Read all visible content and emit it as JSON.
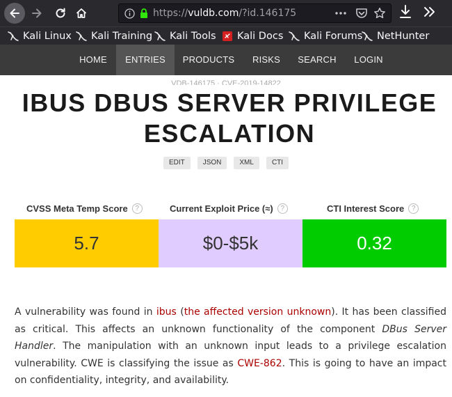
{
  "browser": {
    "url_prefix": "https://",
    "url_host": "vuldb.com",
    "url_path": "/?id.146175",
    "bookmarks": [
      {
        "label": "Kali Linux",
        "icon": "kali-dragon-icon"
      },
      {
        "label": "Kali Training",
        "icon": "kali-dragon-icon"
      },
      {
        "label": "Kali Tools",
        "icon": "kali-dragon-icon"
      },
      {
        "label": "Kali Docs",
        "icon": "kali-docs-icon"
      },
      {
        "label": "Kali Forums",
        "icon": "kali-dragon-icon"
      },
      {
        "label": "NetHunter",
        "icon": "kali-dragon-icon"
      }
    ]
  },
  "nav": {
    "items": [
      "HOME",
      "ENTRIES",
      "PRODUCTS",
      "RISKS",
      "SEARCH",
      "LOGIN"
    ],
    "active": "ENTRIES"
  },
  "entry": {
    "subhead": "VDB-146175 · CVE-2019-14822",
    "title": "IBUS DBUS SERVER PRIVILEGE ESCALATION",
    "formats": [
      "EDIT",
      "JSON",
      "XML",
      "CTI"
    ]
  },
  "scores": {
    "cvss_label": "CVSS Meta Temp Score",
    "cvss_value": "5.7",
    "price_label": "Current Exploit Price (≈)",
    "price_value": "$0-$5k",
    "cti_label": "CTI Interest Score",
    "cti_value": "0.32",
    "help_glyph": "?",
    "colors": {
      "cvss": "#ffcc00",
      "price": "#e0ccff",
      "cti": "#00cc00"
    }
  },
  "description": {
    "p1": "A vulnerability was found in ",
    "product": "ibus",
    "p2": " (",
    "version": "the affected version unknown",
    "p3": "). It has been classified as critical. This affects an unknown functionality of the component ",
    "component": "DBus Server Handler",
    "p4": ". The manipulation with an unknown input leads to a privilege escalation vulnerability. CWE is classifying the issue as ",
    "cwe": "CWE-862",
    "p5": ". This is going to have an impact on confidentiality, integrity, and availability."
  }
}
